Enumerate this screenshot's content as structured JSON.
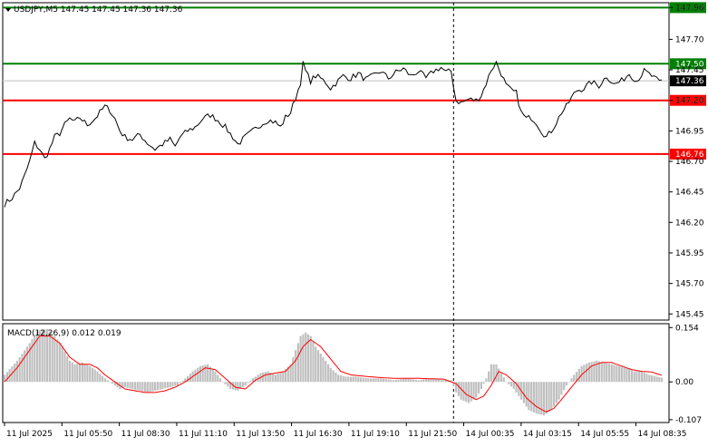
{
  "chart_data": [
    {
      "type": "line",
      "symbol_header": "USDJPY,M5  147.45 147.45 147.36 147.36",
      "y_ticks": [
        "147.96",
        "147.70",
        "147.45",
        "147.20",
        "146.95",
        "146.70",
        "146.45",
        "146.20",
        "145.95",
        "145.70",
        "145.45"
      ],
      "ylim": [
        145.4,
        148.0
      ],
      "x_ticks": [
        "11 Jul 2025",
        "11 Jul 05:50",
        "11 Jul 08:30",
        "11 Jul 11:10",
        "11 Jul 13:50",
        "11 Jul 16:30",
        "11 Jul 19:10",
        "11 Jul 21:50",
        "14 Jul 00:35",
        "14 Jul 03:15",
        "14 Jul 05:55",
        "14 Jul 08:35"
      ],
      "session_break_label": "14 Jul 00:35",
      "levels": [
        {
          "label": "147.96",
          "value": 147.96,
          "color": "#008000"
        },
        {
          "label": "147.50",
          "value": 147.5,
          "color": "#008000"
        },
        {
          "label": "147.20",
          "value": 147.2,
          "color": "#ff0000"
        },
        {
          "label": "146.76",
          "value": 146.76,
          "color": "#ff0000"
        }
      ],
      "current_price": {
        "label": "147.36",
        "value": 147.36
      },
      "price_anchors": [
        [
          0,
          146.35
        ],
        [
          3,
          146.4
        ],
        [
          6,
          146.48
        ],
        [
          8,
          146.58
        ],
        [
          10,
          146.7
        ],
        [
          12,
          146.85
        ],
        [
          14,
          146.8
        ],
        [
          16,
          146.72
        ],
        [
          18,
          146.8
        ],
        [
          20,
          146.9
        ],
        [
          22,
          146.93
        ],
        [
          24,
          147.0
        ],
        [
          26,
          147.05
        ],
        [
          28,
          147.02
        ],
        [
          30,
          147.06
        ],
        [
          33,
          147.0
        ],
        [
          36,
          147.05
        ],
        [
          38,
          147.1
        ],
        [
          40,
          147.15
        ],
        [
          42,
          147.12
        ],
        [
          44,
          147.05
        ],
        [
          46,
          146.95
        ],
        [
          48,
          146.9
        ],
        [
          51,
          146.88
        ],
        [
          54,
          146.92
        ],
        [
          57,
          146.85
        ],
        [
          60,
          146.8
        ],
        [
          63,
          146.84
        ],
        [
          66,
          146.88
        ],
        [
          68,
          146.82
        ],
        [
          70,
          146.9
        ],
        [
          73,
          146.95
        ],
        [
          76,
          146.98
        ],
        [
          79,
          147.05
        ],
        [
          82,
          147.08
        ],
        [
          85,
          147.04
        ],
        [
          88,
          146.98
        ],
        [
          91,
          146.9
        ],
        [
          93,
          146.84
        ],
        [
          96,
          146.9
        ],
        [
          99,
          146.95
        ],
        [
          102,
          147.0
        ],
        [
          105,
          147.04
        ],
        [
          108,
          147.02
        ],
        [
          110,
          146.98
        ],
        [
          112,
          147.06
        ],
        [
          114,
          147.1
        ],
        [
          116,
          147.22
        ],
        [
          118,
          147.35
        ],
        [
          119,
          147.5
        ],
        [
          120,
          147.44
        ],
        [
          122,
          147.36
        ],
        [
          124,
          147.4
        ],
        [
          126,
          147.38
        ],
        [
          128,
          147.35
        ],
        [
          130,
          147.3
        ],
        [
          132,
          147.34
        ],
        [
          135,
          147.4
        ],
        [
          138,
          147.38
        ],
        [
          141,
          147.42
        ],
        [
          144,
          147.37
        ],
        [
          147,
          147.4
        ],
        [
          150,
          147.44
        ],
        [
          153,
          147.38
        ],
        [
          156,
          147.43
        ],
        [
          159,
          147.46
        ],
        [
          162,
          147.4
        ],
        [
          165,
          147.44
        ],
        [
          168,
          147.38
        ],
        [
          171,
          147.44
        ],
        [
          174,
          147.47
        ],
        [
          176,
          147.43
        ],
        [
          178,
          147.44
        ],
        [
          180,
          147.2
        ],
        [
          182,
          147.18
        ],
        [
          185,
          147.21
        ],
        [
          188,
          147.2
        ],
        [
          190,
          147.24
        ],
        [
          192,
          147.34
        ],
        [
          194,
          147.45
        ],
        [
          196,
          147.51
        ],
        [
          198,
          147.42
        ],
        [
          200,
          147.32
        ],
        [
          202,
          147.28
        ],
        [
          204,
          147.26
        ],
        [
          206,
          147.1
        ],
        [
          208,
          147.05
        ],
        [
          210,
          147.06
        ],
        [
          212,
          147.02
        ],
        [
          214,
          146.95
        ],
        [
          216,
          146.9
        ],
        [
          218,
          146.95
        ],
        [
          220,
          147.02
        ],
        [
          222,
          147.1
        ],
        [
          224,
          147.15
        ],
        [
          226,
          147.22
        ],
        [
          228,
          147.28
        ],
        [
          231,
          147.3
        ],
        [
          234,
          147.35
        ],
        [
          237,
          147.32
        ],
        [
          240,
          147.4
        ],
        [
          243,
          147.33
        ],
        [
          246,
          147.36
        ],
        [
          249,
          147.42
        ],
        [
          252,
          147.36
        ],
        [
          255,
          147.44
        ],
        [
          258,
          147.4
        ],
        [
          261,
          147.35
        ],
        [
          262,
          147.36
        ]
      ],
      "max_bar_index": 262
    },
    {
      "type": "bar",
      "indicator_label": "MACD(12,26,9) 0.012 0.019",
      "y_ticks": [
        "0.154",
        "0.00",
        "-0.107"
      ],
      "ylim": [
        -0.115,
        0.165
      ],
      "series": [
        {
          "name": "MACD",
          "kind": "histogram",
          "color": "#c0c0c0",
          "anchors": [
            [
              0,
              0.02
            ],
            [
              5,
              0.06
            ],
            [
              10,
              0.11
            ],
            [
              13,
              0.145
            ],
            [
              17,
              0.15
            ],
            [
              20,
              0.13
            ],
            [
              23,
              0.1
            ],
            [
              26,
              0.06
            ],
            [
              28,
              0.05
            ],
            [
              31,
              0.055
            ],
            [
              34,
              0.045
            ],
            [
              37,
              0.03
            ],
            [
              40,
              0.01
            ],
            [
              43,
              -0.005
            ],
            [
              46,
              -0.02
            ],
            [
              48,
              -0.015
            ],
            [
              51,
              -0.02
            ],
            [
              54,
              -0.025
            ],
            [
              57,
              -0.03
            ],
            [
              60,
              -0.025
            ],
            [
              63,
              -0.02
            ],
            [
              66,
              -0.015
            ],
            [
              69,
              -0.01
            ],
            [
              72,
              0.01
            ],
            [
              75,
              0.03
            ],
            [
              78,
              0.045
            ],
            [
              81,
              0.05
            ],
            [
              84,
              0.03
            ],
            [
              87,
              0.0
            ],
            [
              90,
              -0.02
            ],
            [
              93,
              -0.025
            ],
            [
              96,
              -0.01
            ],
            [
              99,
              0.01
            ],
            [
              102,
              0.025
            ],
            [
              105,
              0.03
            ],
            [
              108,
              0.02
            ],
            [
              111,
              0.03
            ],
            [
              114,
              0.05
            ],
            [
              116,
              0.09
            ],
            [
              118,
              0.13
            ],
            [
              120,
              0.14
            ],
            [
              122,
              0.13
            ],
            [
              124,
              0.1
            ],
            [
              127,
              0.07
            ],
            [
              130,
              0.04
            ],
            [
              133,
              0.02
            ],
            [
              136,
              0.015
            ],
            [
              140,
              0.015
            ],
            [
              145,
              0.01
            ],
            [
              150,
              0.01
            ],
            [
              155,
              0.005
            ],
            [
              160,
              0.01
            ],
            [
              165,
              0.005
            ],
            [
              170,
              0.01
            ],
            [
              175,
              0.005
            ],
            [
              178,
              0.005
            ],
            [
              180,
              -0.03
            ],
            [
              182,
              -0.05
            ],
            [
              185,
              -0.06
            ],
            [
              188,
              -0.045
            ],
            [
              190,
              -0.02
            ],
            [
              192,
              0.01
            ],
            [
              194,
              0.05
            ],
            [
              196,
              0.05
            ],
            [
              198,
              0.025
            ],
            [
              200,
              0.0
            ],
            [
              203,
              -0.02
            ],
            [
              206,
              -0.05
            ],
            [
              209,
              -0.08
            ],
            [
              212,
              -0.09
            ],
            [
              215,
              -0.095
            ],
            [
              218,
              -0.08
            ],
            [
              221,
              -0.05
            ],
            [
              224,
              -0.01
            ],
            [
              227,
              0.02
            ],
            [
              230,
              0.045
            ],
            [
              233,
              0.055
            ],
            [
              236,
              0.06
            ],
            [
              239,
              0.055
            ],
            [
              242,
              0.05
            ],
            [
              245,
              0.045
            ],
            [
              248,
              0.04
            ],
            [
              251,
              0.03
            ],
            [
              254,
              0.03
            ],
            [
              257,
              0.02
            ],
            [
              260,
              0.015
            ],
            [
              262,
              0.012
            ]
          ]
        },
        {
          "name": "Signal",
          "kind": "line",
          "color": "#ff0000",
          "anchors": [
            [
              0,
              0.0
            ],
            [
              5,
              0.04
            ],
            [
              10,
              0.09
            ],
            [
              14,
              0.13
            ],
            [
              18,
              0.13
            ],
            [
              22,
              0.11
            ],
            [
              26,
              0.07
            ],
            [
              30,
              0.05
            ],
            [
              34,
              0.05
            ],
            [
              37,
              0.04
            ],
            [
              40,
              0.02
            ],
            [
              44,
              0.0
            ],
            [
              48,
              -0.02
            ],
            [
              52,
              -0.025
            ],
            [
              56,
              -0.03
            ],
            [
              60,
              -0.03
            ],
            [
              64,
              -0.025
            ],
            [
              68,
              -0.015
            ],
            [
              72,
              0.0
            ],
            [
              76,
              0.02
            ],
            [
              80,
              0.04
            ],
            [
              84,
              0.035
            ],
            [
              88,
              0.01
            ],
            [
              92,
              -0.015
            ],
            [
              96,
              -0.02
            ],
            [
              100,
              0.005
            ],
            [
              104,
              0.02
            ],
            [
              108,
              0.025
            ],
            [
              112,
              0.03
            ],
            [
              116,
              0.06
            ],
            [
              119,
              0.1
            ],
            [
              122,
              0.12
            ],
            [
              126,
              0.1
            ],
            [
              130,
              0.065
            ],
            [
              134,
              0.03
            ],
            [
              138,
              0.02
            ],
            [
              145,
              0.015
            ],
            [
              155,
              0.01
            ],
            [
              165,
              0.01
            ],
            [
              175,
              0.008
            ],
            [
              180,
              -0.005
            ],
            [
              184,
              -0.035
            ],
            [
              188,
              -0.05
            ],
            [
              191,
              -0.04
            ],
            [
              194,
              -0.01
            ],
            [
              197,
              0.03
            ],
            [
              200,
              0.02
            ],
            [
              204,
              -0.005
            ],
            [
              208,
              -0.045
            ],
            [
              212,
              -0.07
            ],
            [
              216,
              -0.085
            ],
            [
              219,
              -0.075
            ],
            [
              222,
              -0.05
            ],
            [
              226,
              -0.015
            ],
            [
              230,
              0.02
            ],
            [
              234,
              0.045
            ],
            [
              238,
              0.055
            ],
            [
              242,
              0.055
            ],
            [
              246,
              0.045
            ],
            [
              250,
              0.035
            ],
            [
              254,
              0.03
            ],
            [
              258,
              0.028
            ],
            [
              262,
              0.019
            ]
          ]
        }
      ]
    }
  ]
}
